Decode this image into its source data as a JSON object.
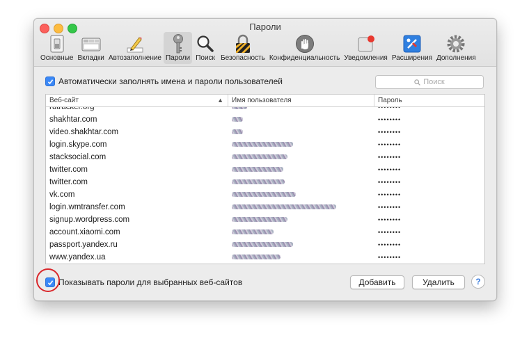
{
  "window": {
    "title": "Пароли"
  },
  "toolbar": {
    "items": [
      {
        "label": "Основные",
        "icon": "switch-icon",
        "selected": false
      },
      {
        "label": "Вкладки",
        "icon": "tabs-icon",
        "selected": false
      },
      {
        "label": "Автозаполнение",
        "icon": "pencil-icon",
        "selected": false
      },
      {
        "label": "Пароли",
        "icon": "key-icon",
        "selected": true
      },
      {
        "label": "Поиск",
        "icon": "magnifier-icon",
        "selected": false
      },
      {
        "label": "Безопасность",
        "icon": "lock-icon",
        "selected": false
      },
      {
        "label": "Конфиденциальность",
        "icon": "hand-icon",
        "selected": false
      },
      {
        "label": "Уведомления",
        "icon": "notification-icon",
        "selected": false
      },
      {
        "label": "Расширения",
        "icon": "puzzle-icon",
        "selected": false
      },
      {
        "label": "Дополнения",
        "icon": "gear-icon",
        "selected": false
      }
    ]
  },
  "autofill": {
    "label": "Автоматически заполнять имена и пароли пользователей",
    "checked": true
  },
  "search": {
    "placeholder": "Поиск"
  },
  "table": {
    "columns": [
      "Веб-сайт",
      "Имя пользователя",
      "Пароль"
    ],
    "rows": [
      {
        "site": "rutracker.org",
        "password": "••••••••"
      },
      {
        "site": "shakhtar.com",
        "password": "••••••••"
      },
      {
        "site": "video.shakhtar.com",
        "password": "••••••••"
      },
      {
        "site": "login.skype.com",
        "password": "••••••••"
      },
      {
        "site": "stacksocial.com",
        "password": "••••••••"
      },
      {
        "site": "twitter.com",
        "password": "••••••••"
      },
      {
        "site": "twitter.com",
        "password": "••••••••"
      },
      {
        "site": "vk.com",
        "password": "••••••••"
      },
      {
        "site": "login.wmtransfer.com",
        "password": "••••••••"
      },
      {
        "site": "signup.wordpress.com",
        "password": "••••••••"
      },
      {
        "site": "account.xiaomi.com",
        "password": "••••••••"
      },
      {
        "site": "passport.yandex.ru",
        "password": "••••••••"
      },
      {
        "site": "www.yandex.ua",
        "password": "••••••••"
      }
    ]
  },
  "show_passwords": {
    "label": "Показывать пароли для выбранных веб-сайтов",
    "checked": true
  },
  "buttons": {
    "add": "Добавить",
    "delete": "Удалить",
    "help": "?"
  },
  "colors": {
    "accent": "#3b88f6",
    "highlight_circle": "#d9262a"
  }
}
